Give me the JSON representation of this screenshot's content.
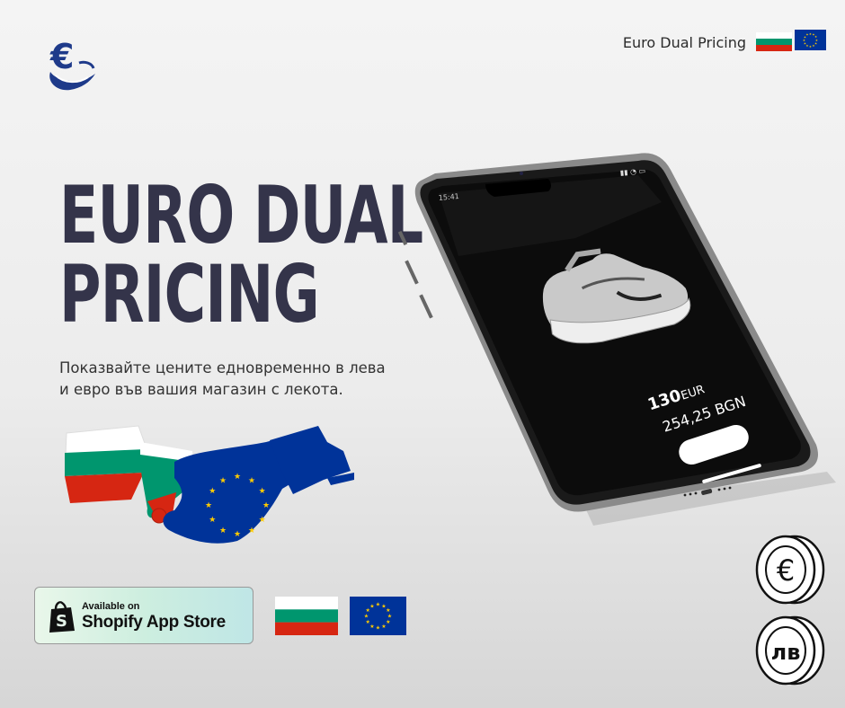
{
  "header": {
    "label": "Euro Dual Pricing"
  },
  "hero": {
    "title_line1": "EURO DUAL",
    "title_line2": "PRICING",
    "subtitle_line1": "Показвайте цените едновременно в лева",
    "subtitle_line2": "и евро във вашия магазин с лекота."
  },
  "phone": {
    "status_time": "15:41",
    "price_eur_amount": "130",
    "price_eur_currency": "EUR",
    "price_bgn": "254,25 BGN"
  },
  "badge": {
    "small": "Available on",
    "big": "Shopify App Store"
  },
  "coins": {
    "euro_symbol": "€",
    "lev_symbol": "лв"
  },
  "colors": {
    "headline": "#34344a",
    "bulgaria_white": "#ffffff",
    "bulgaria_green": "#00966e",
    "bulgaria_red": "#d62612",
    "eu_blue": "#003399",
    "eu_star": "#ffcc00"
  },
  "icons": [
    "euro-hands-logo-icon",
    "bulgaria-flag-icon",
    "eu-flag-icon",
    "shopify-bag-icon",
    "euro-coin-icon",
    "lev-coin-icon",
    "sneaker-image"
  ]
}
